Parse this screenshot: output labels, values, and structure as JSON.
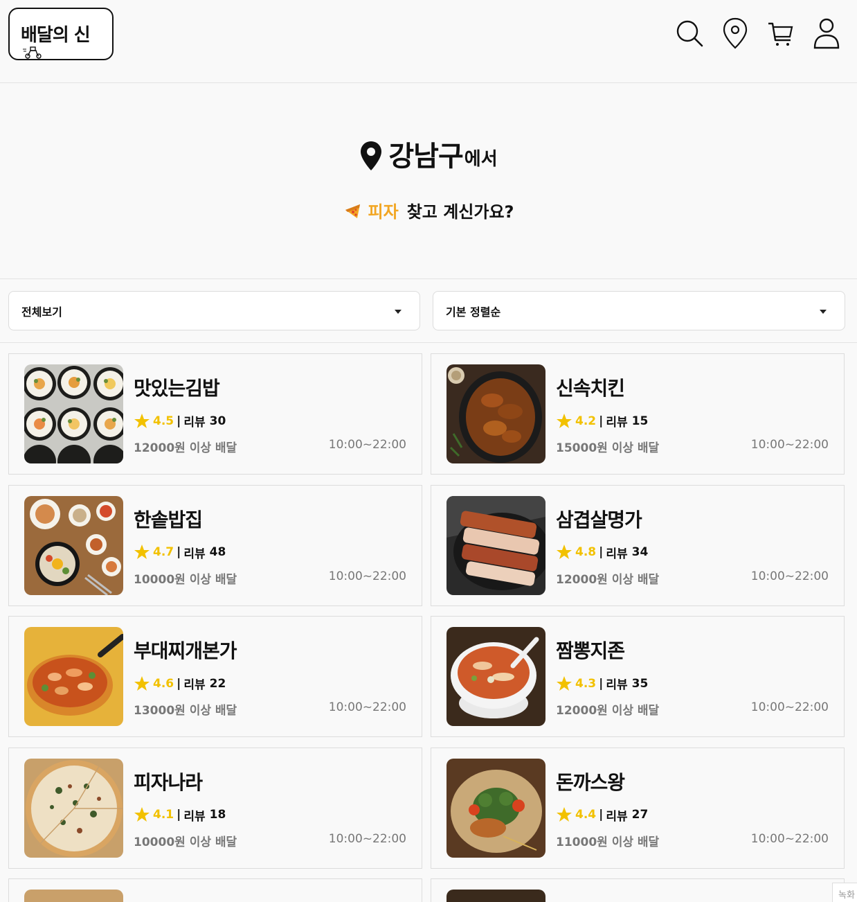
{
  "header": {
    "logo_text": "배달의 신",
    "icons": [
      "search-icon",
      "location-pin-icon",
      "cart-icon",
      "user-icon"
    ]
  },
  "hero": {
    "location": "강남구",
    "location_suffix": "에서",
    "category": "피자",
    "question": "찾고 계신가요?"
  },
  "filters": {
    "category_select": "전체보기",
    "sort_select": "기본 정렬순"
  },
  "review_label": "리뷰",
  "colors": {
    "accent": "#f2a623",
    "star": "#f2c100"
  },
  "restaurants": [
    {
      "name": "맛있는김밥",
      "rating": "4.5",
      "reviews": "30",
      "min_order": "12000원 이상 배달",
      "hours": "10:00~22:00",
      "image": "gimbap"
    },
    {
      "name": "신속치킨",
      "rating": "4.2",
      "reviews": "15",
      "min_order": "15000원 이상 배달",
      "hours": "10:00~22:00",
      "image": "chicken"
    },
    {
      "name": "한솥밥집",
      "rating": "4.7",
      "reviews": "48",
      "min_order": "10000원 이상 배달",
      "hours": "10:00~22:00",
      "image": "bibimbap"
    },
    {
      "name": "삼겹살명가",
      "rating": "4.8",
      "reviews": "34",
      "min_order": "12000원 이상 배달",
      "hours": "10:00~22:00",
      "image": "pork-belly"
    },
    {
      "name": "부대찌개본가",
      "rating": "4.6",
      "reviews": "22",
      "min_order": "13000원 이상 배달",
      "hours": "10:00~22:00",
      "image": "stew"
    },
    {
      "name": "짬뽕지존",
      "rating": "4.3",
      "reviews": "35",
      "min_order": "12000원 이상 배달",
      "hours": "10:00~22:00",
      "image": "jjamppong"
    },
    {
      "name": "피자나라",
      "rating": "4.1",
      "reviews": "18",
      "min_order": "10000원 이상 배달",
      "hours": "10:00~22:00",
      "image": "pizza"
    },
    {
      "name": "돈까스왕",
      "rating": "4.4",
      "reviews": "27",
      "min_order": "11000원 이상 배달",
      "hours": "10:00~22:00",
      "image": "tonkatsu"
    }
  ],
  "corner_badge": "녹화"
}
